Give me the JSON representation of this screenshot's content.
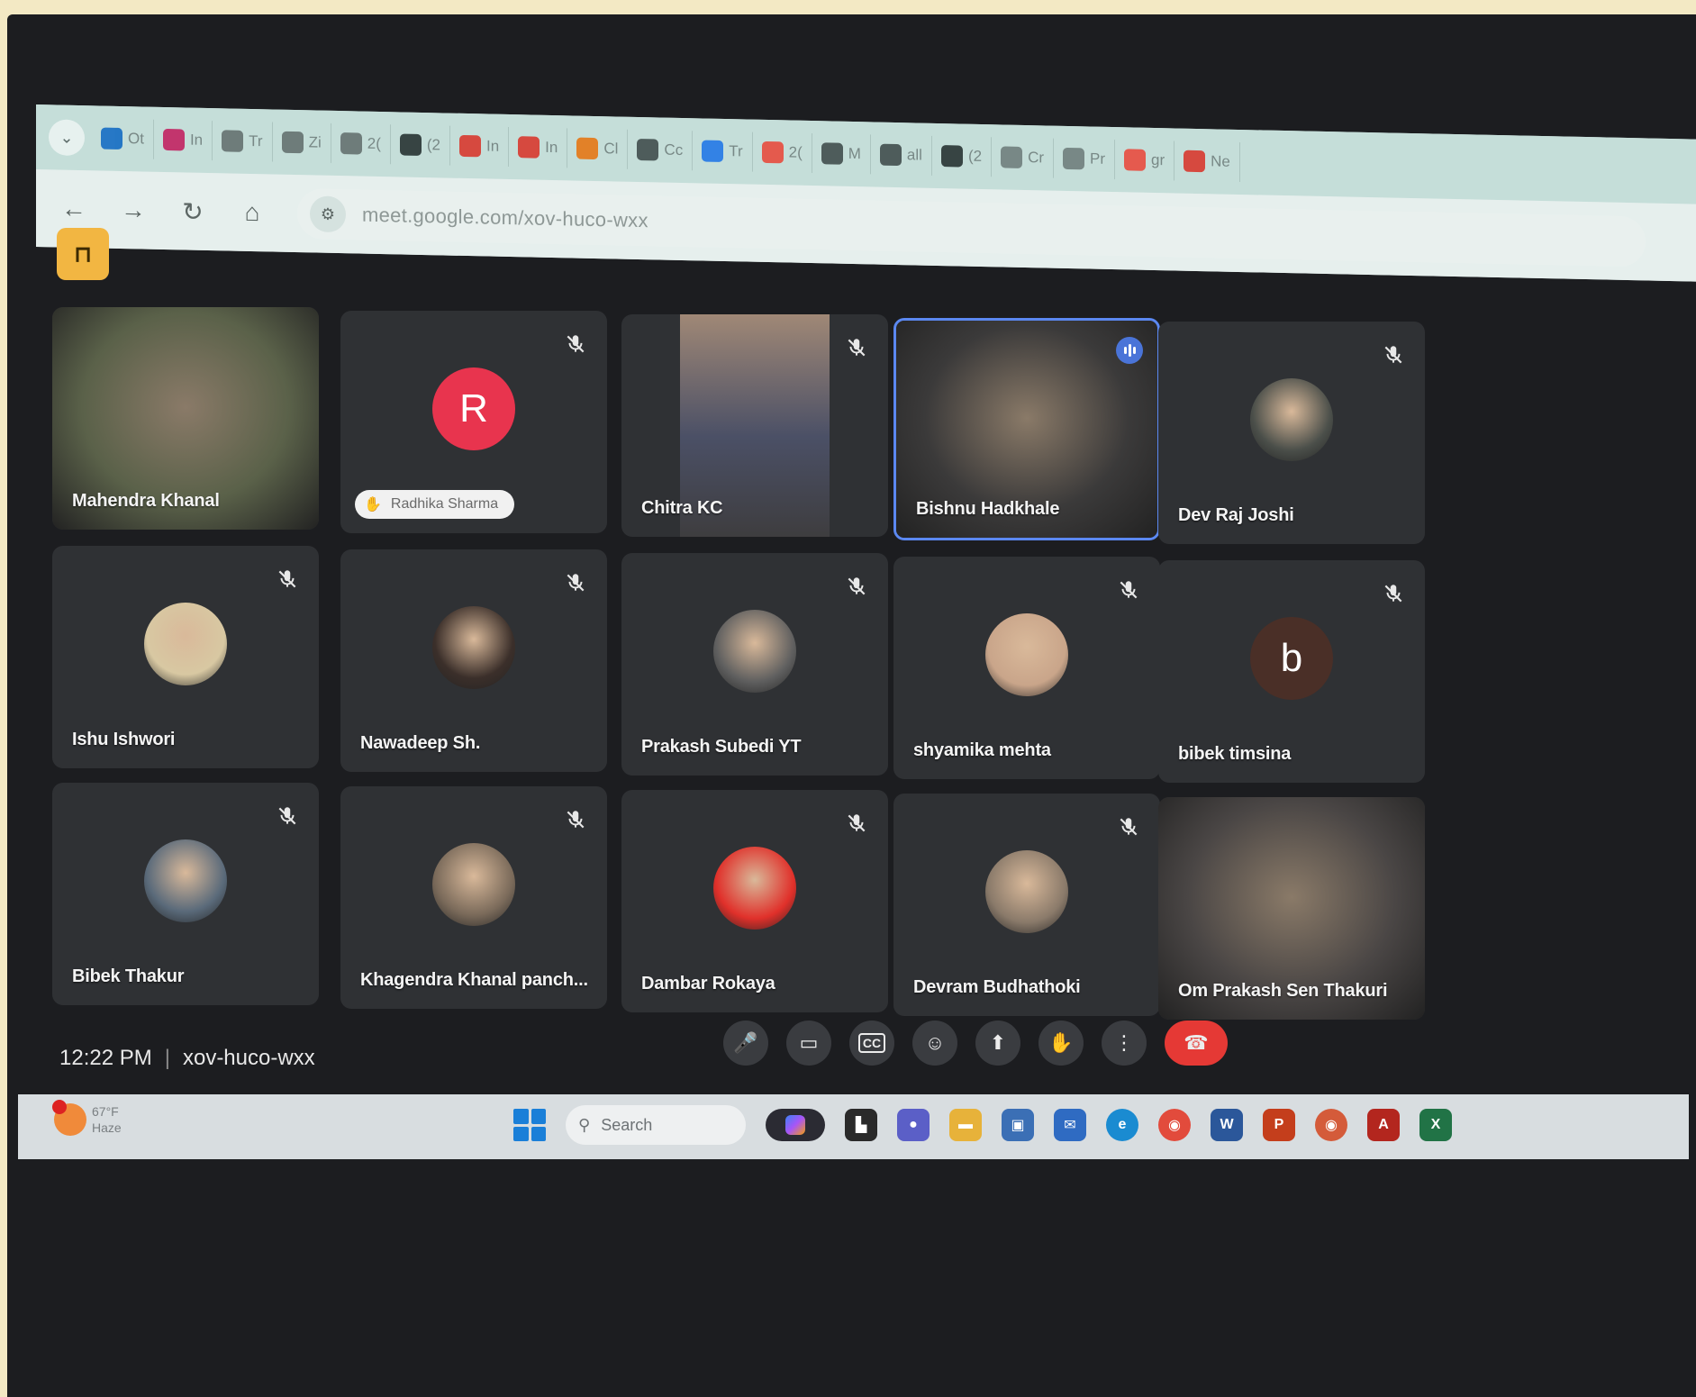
{
  "browser": {
    "tabs": [
      {
        "icon": "outlook-icon",
        "label": "Ot",
        "color": "#0a66c2"
      },
      {
        "icon": "gallery-icon",
        "label": "In",
        "color": "#c2185b"
      },
      {
        "icon": "globe-icon",
        "label": "Tr",
        "color": "#5f6b6a"
      },
      {
        "icon": "globe-icon",
        "label": "Zi",
        "color": "#5f6b6a"
      },
      {
        "icon": "whatsapp-icon",
        "label": "2(",
        "color": "#5f6b6a"
      },
      {
        "icon": "doc-icon",
        "label": "(2",
        "color": "#1f2a2a"
      },
      {
        "icon": "gmail-icon",
        "label": "In",
        "color": "#d93025"
      },
      {
        "icon": "gmail-icon",
        "label": "In",
        "color": "#d93025"
      },
      {
        "icon": "fire-icon",
        "label": "Cl",
        "color": "#e8710a"
      },
      {
        "icon": "wordpress-icon",
        "label": "Cc",
        "color": "#3a4646"
      },
      {
        "icon": "chat-icon",
        "label": "Tr",
        "color": "#1a73e8"
      },
      {
        "icon": "google-icon",
        "label": "2(",
        "color": "#ea4335"
      },
      {
        "icon": "globe-icon",
        "label": "M",
        "color": "#3a4646"
      },
      {
        "icon": "globe-icon",
        "label": "all",
        "color": "#3a4646"
      },
      {
        "icon": "x-icon",
        "label": "(2",
        "color": "#1f2a2a"
      },
      {
        "icon": "box-icon",
        "label": "Cr",
        "color": "#6b7a78"
      },
      {
        "icon": "card-icon",
        "label": "Pr",
        "color": "#6b7a78"
      },
      {
        "icon": "google-icon",
        "label": "gr",
        "color": "#ea4335"
      },
      {
        "icon": "grid-icon",
        "label": "Ne",
        "color": "#d93025"
      }
    ],
    "url": "meet.google.com/xov-huco-wxx"
  },
  "participants": [
    {
      "name": "Mahendra Khanal",
      "type": "video",
      "bg": "#5a6149",
      "muted": false
    },
    {
      "name": "Radhika Sharma",
      "type": "letter",
      "letter": "R",
      "avatar_color": "#e8344e",
      "hand_raised": true,
      "muted": true
    },
    {
      "name": "Chitra KC",
      "type": "video-portrait",
      "bg": "#4d4a48",
      "muted": true
    },
    {
      "name": "Bishnu Hadkhale",
      "type": "video",
      "bg": "#3b3a3a",
      "speaking": true,
      "muted": false
    },
    {
      "name": "Dev Raj Joshi",
      "type": "photo",
      "avatar_color": "#4b4f4a",
      "muted": true
    },
    {
      "name": "Ishu Ishwori",
      "type": "photo",
      "avatar_color": "#d8c8a2",
      "muted": true
    },
    {
      "name": "Nawadeep Sh.",
      "type": "photo",
      "avatar_color": "#3b2f2a",
      "muted": true
    },
    {
      "name": "Prakash Subedi YT",
      "type": "photo",
      "avatar_color": "#5f5f5f",
      "muted": true
    },
    {
      "name": "shyamika mehta",
      "type": "photo",
      "avatar_color": "#c9a58a",
      "muted": true
    },
    {
      "name": "bibek timsina",
      "type": "letter",
      "letter": "b",
      "avatar_color": "#4a2f27",
      "muted": true
    },
    {
      "name": "Bibek Thakur",
      "type": "photo",
      "avatar_color": "#5a6a7a",
      "muted": true
    },
    {
      "name": "Khagendra Khanal panch...",
      "type": "photo",
      "avatar_color": "#7a6a5a",
      "muted": true
    },
    {
      "name": "Dambar Rokaya",
      "type": "photo",
      "avatar_color": "#e0302a",
      "muted": true
    },
    {
      "name": "Devram Budhathoki",
      "type": "photo",
      "avatar_color": "#8a7a6a",
      "muted": true
    },
    {
      "name": "Om Prakash Sen Thakuri",
      "type": "video",
      "bg": "#4a4645",
      "muted": false
    }
  ],
  "meeting": {
    "time": "12:22 PM",
    "code": "xov-huco-wxx"
  },
  "controls": [
    {
      "name": "microphone-button",
      "glyph": "🎤"
    },
    {
      "name": "camera-button",
      "glyph": "▭"
    },
    {
      "name": "captions-button",
      "glyph": "CC"
    },
    {
      "name": "emoji-button",
      "glyph": "☺"
    },
    {
      "name": "present-button",
      "glyph": "⬆"
    },
    {
      "name": "raise-hand-button",
      "glyph": "✋"
    },
    {
      "name": "more-options-button",
      "glyph": "⋮"
    },
    {
      "name": "leave-call-button",
      "glyph": "☎"
    }
  ],
  "taskbar": {
    "weather_temp": "67°F",
    "weather_desc": "Haze",
    "search_placeholder": "Search"
  }
}
